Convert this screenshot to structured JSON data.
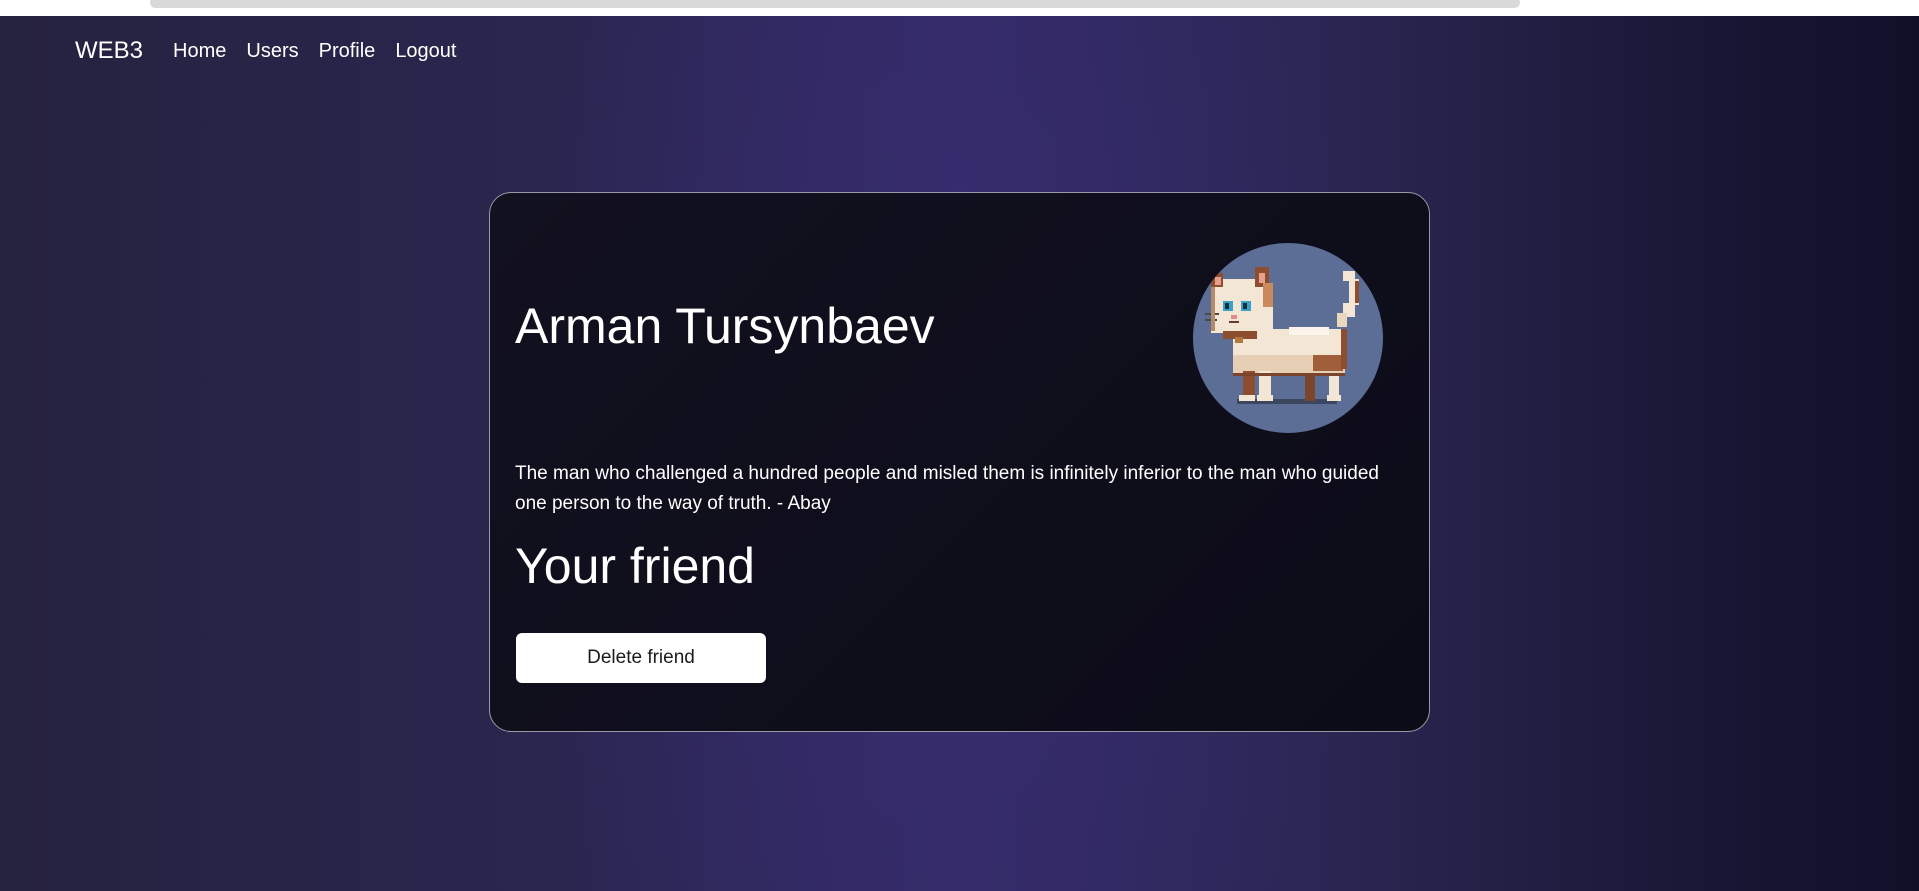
{
  "nav": {
    "brand": "WEB3",
    "links": [
      "Home",
      "Users",
      "Profile",
      "Logout"
    ]
  },
  "profile": {
    "name": "Arman Tursynbaev",
    "quote": "The man who challenged a hundred people and misled them is infinitely inferior to the man who guided one person to the way of truth. - Abay",
    "friend_status": "Your friend",
    "delete_button": "Delete friend",
    "avatar_icon": "pixel-cat-avatar"
  },
  "colors": {
    "page_background": "#2a2650",
    "card_background": "#0f0e1c",
    "avatar_background": "#5c6e96",
    "button_background": "#ffffff",
    "text": "#ffffff"
  }
}
